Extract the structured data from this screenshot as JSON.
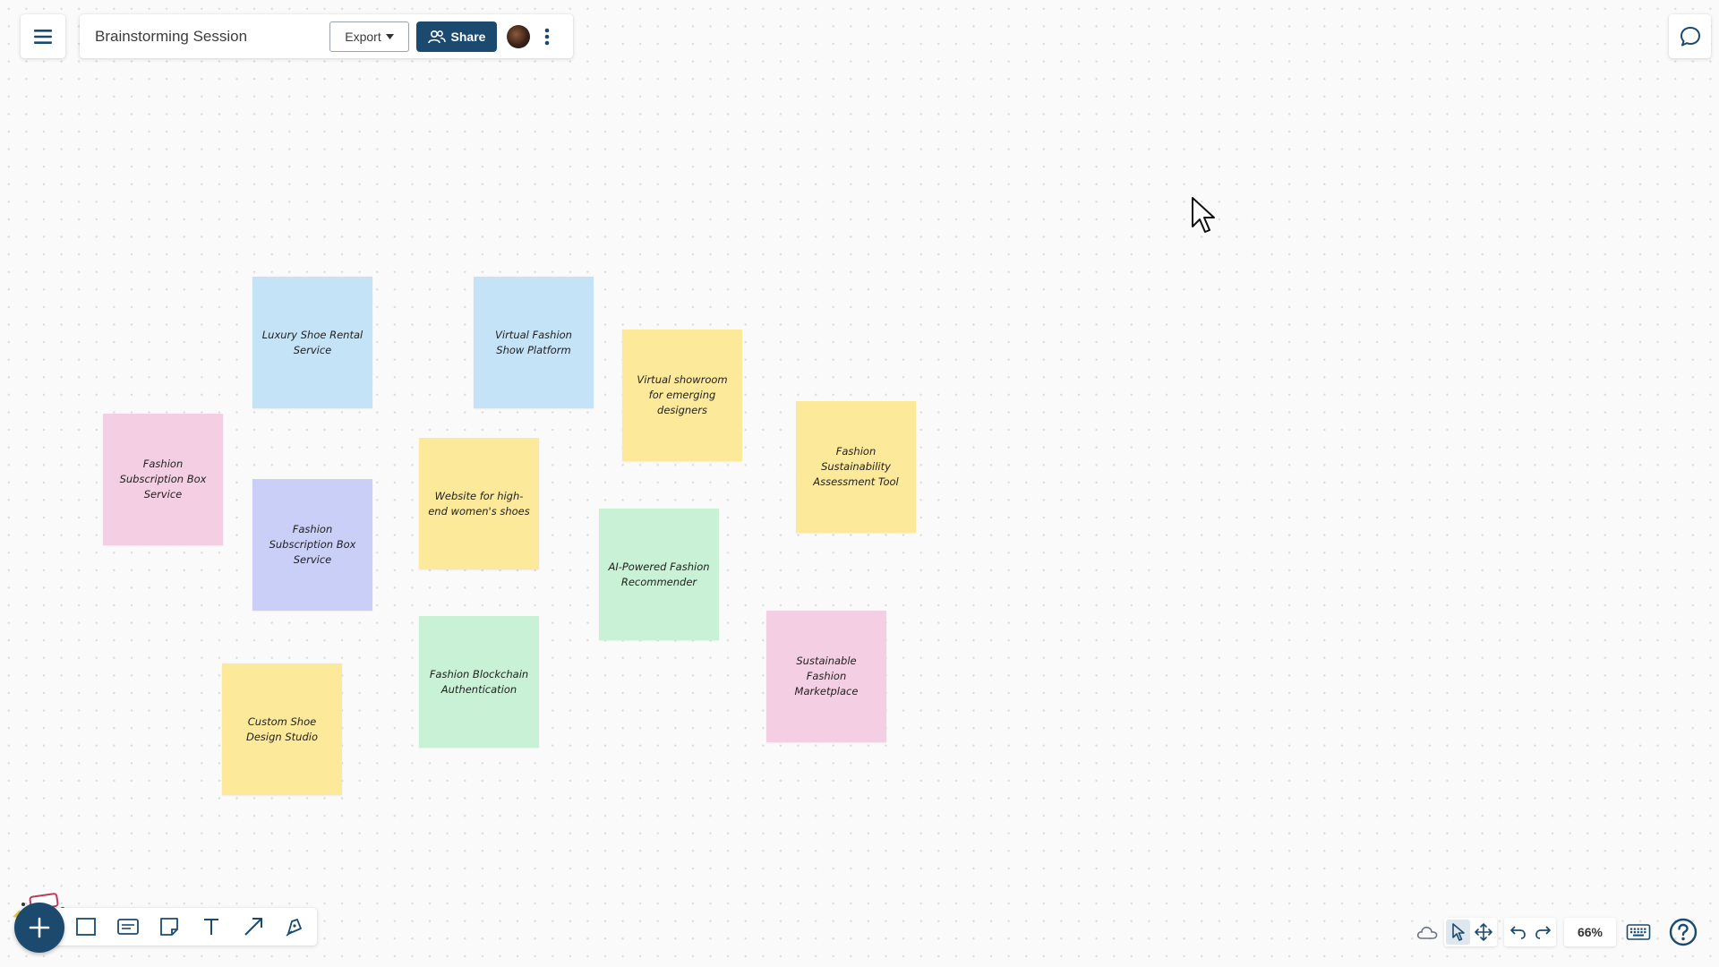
{
  "header": {
    "board_title": "Brainstorming Session",
    "export_label": "Export",
    "share_label": "Share"
  },
  "canvas": {
    "notes": [
      {
        "text": "Luxury Shoe Rental Service",
        "color": "#c4e3f7"
      },
      {
        "text": "Virtual Fashion Show Platform",
        "color": "#c4e3f7"
      },
      {
        "text": "Virtual showroom for emerging designers",
        "color": "#fde99a"
      },
      {
        "text": "Fashion Subscription Box Service",
        "color": "#f4cfe3"
      },
      {
        "text": "Fashion Subscription Box Service",
        "color": "#c9cff7"
      },
      {
        "text": "Website for high-end women's shoes",
        "color": "#fde99a"
      },
      {
        "text": "Fashion Sustainability Assessment Tool",
        "color": "#fde99a"
      },
      {
        "text": "AI-Powered Fashion Recommender",
        "color": "#c8f1d5"
      },
      {
        "text": "Custom Shoe Design Studio",
        "color": "#fde99a"
      },
      {
        "text": "Fashion Blockchain Authentication",
        "color": "#c8f1d5"
      },
      {
        "text": "Sustainable Fashion Marketplace",
        "color": "#f4cfe3"
      }
    ]
  },
  "toolbar": {
    "tools": [
      "add-icon",
      "rectangle-icon",
      "card-icon",
      "sticky-note-icon",
      "text-icon",
      "arrow-icon",
      "pen-icon"
    ]
  },
  "bottom_right": {
    "zoom_label": "66%"
  },
  "colors": {
    "accent": "#1c4a6e"
  }
}
